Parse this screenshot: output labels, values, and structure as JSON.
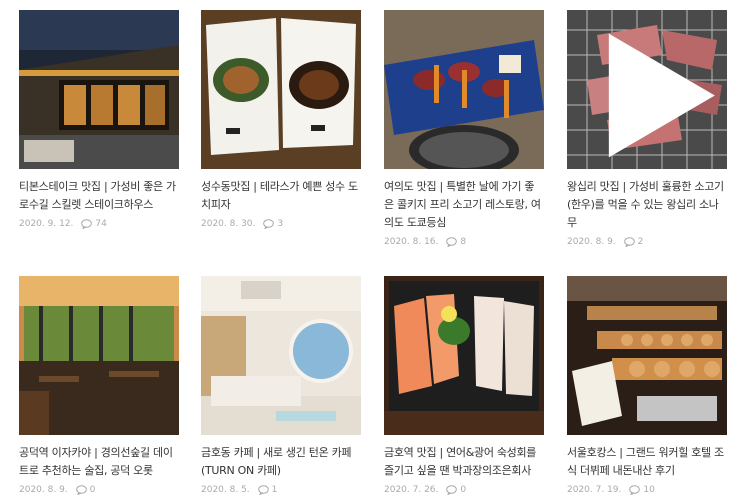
{
  "posts": [
    {
      "title": "티본스테이크 맛집 | 가성비 좋은 가로수길 스킬렛 스테이크하우스",
      "date": "2020. 9. 12.",
      "comments": "74"
    },
    {
      "title": "성수동맛집 | 테라스가 예쁜 성수 도치피자",
      "date": "2020. 8. 30.",
      "comments": "3"
    },
    {
      "title": "여의도 맛집 | 특별한 날에 가기 좋은 콜키지 프리 소고기 레스토랑, 여의도 도쿄등심",
      "date": "2020. 8. 16.",
      "comments": "8"
    },
    {
      "title": "왕십리 맛집 | 가성비 훌륭한 소고기(한우)를 먹을 수 있는 왕십리 소나무",
      "date": "2020. 8. 9.",
      "comments": "2"
    },
    {
      "title": "공덕역 이자카야 | 경의선숲길 데이트로 추천하는 술집, 공덕 오롯",
      "date": "2020. 8. 9.",
      "comments": "0"
    },
    {
      "title": "금호동 카페 | 새로 생긴 턴온 카페(TURN ON 카페)",
      "date": "2020. 8. 5.",
      "comments": "1"
    },
    {
      "title": "금호역 맛집 | 연어&광어 숙성회를 즐기고 싶을 땐 박과장의조은회사",
      "date": "2020. 7. 26.",
      "comments": "0"
    },
    {
      "title": "서울호캉스 | 그랜드 워커힐 호텔 조식 더뷔페 내돈내산 후기",
      "date": "2020. 7. 19.",
      "comments": "10"
    }
  ],
  "icons": {
    "comment": "comment-bubble-icon",
    "play": "play-icon"
  }
}
